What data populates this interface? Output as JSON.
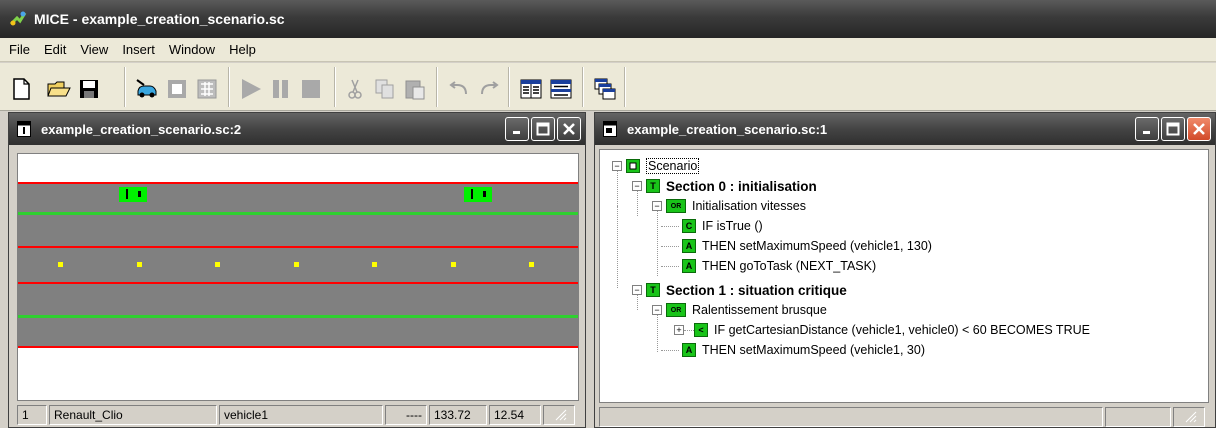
{
  "app": {
    "title": "MICE - example_creation_scenario.sc"
  },
  "menu": [
    "File",
    "Edit",
    "View",
    "Insert",
    "Window",
    "Help"
  ],
  "toolbar": {
    "buttons": [
      "new-file",
      "open-folder",
      "save",
      "vehicle",
      "stop-square",
      "grid",
      "play",
      "pause",
      "stop",
      "cut",
      "copy",
      "paste",
      "undo",
      "redo",
      "tile-vertical",
      "tile-horizontal",
      "cascade"
    ]
  },
  "left_window": {
    "title": "example_creation_scenario.sc:2",
    "status": [
      "1",
      "Renault_Clio",
      "vehicle1",
      "----",
      "133.72",
      "12.54"
    ]
  },
  "right_window": {
    "title": "example_creation_scenario.sc:1",
    "tree": {
      "root": "Scenario",
      "section0": {
        "icon": "T",
        "label": "Section 0 : initialisation"
      },
      "group0": {
        "icon": "OR",
        "label": "Initialisation vitesses"
      },
      "cond0": {
        "icon": "C",
        "label": "IF   isTrue  ()"
      },
      "act0a": {
        "icon": "A",
        "label": "THEN  setMaximumSpeed  (vehicle1, 130)"
      },
      "act0b": {
        "icon": "A",
        "label": "THEN  goToTask  (NEXT_TASK)"
      },
      "section1": {
        "icon": "T",
        "label": "Section 1 : situation critique"
      },
      "group1": {
        "icon": "OR",
        "label": "Ralentissement brusque"
      },
      "cond1": {
        "icon": "<",
        "label": "IF   getCartesianDistance  (vehicle1, vehicle0)  <  60    BECOMES TRUE"
      },
      "act1": {
        "icon": "A",
        "label": "THEN  setMaximumSpeed  (vehicle1, 30)"
      }
    }
  },
  "colors": {
    "road": "#808080",
    "lane_red": "#ff0000",
    "lane_green": "#2fd030",
    "marker": "#ffff00",
    "vehicle": "#00f000",
    "node": "#19c419"
  }
}
